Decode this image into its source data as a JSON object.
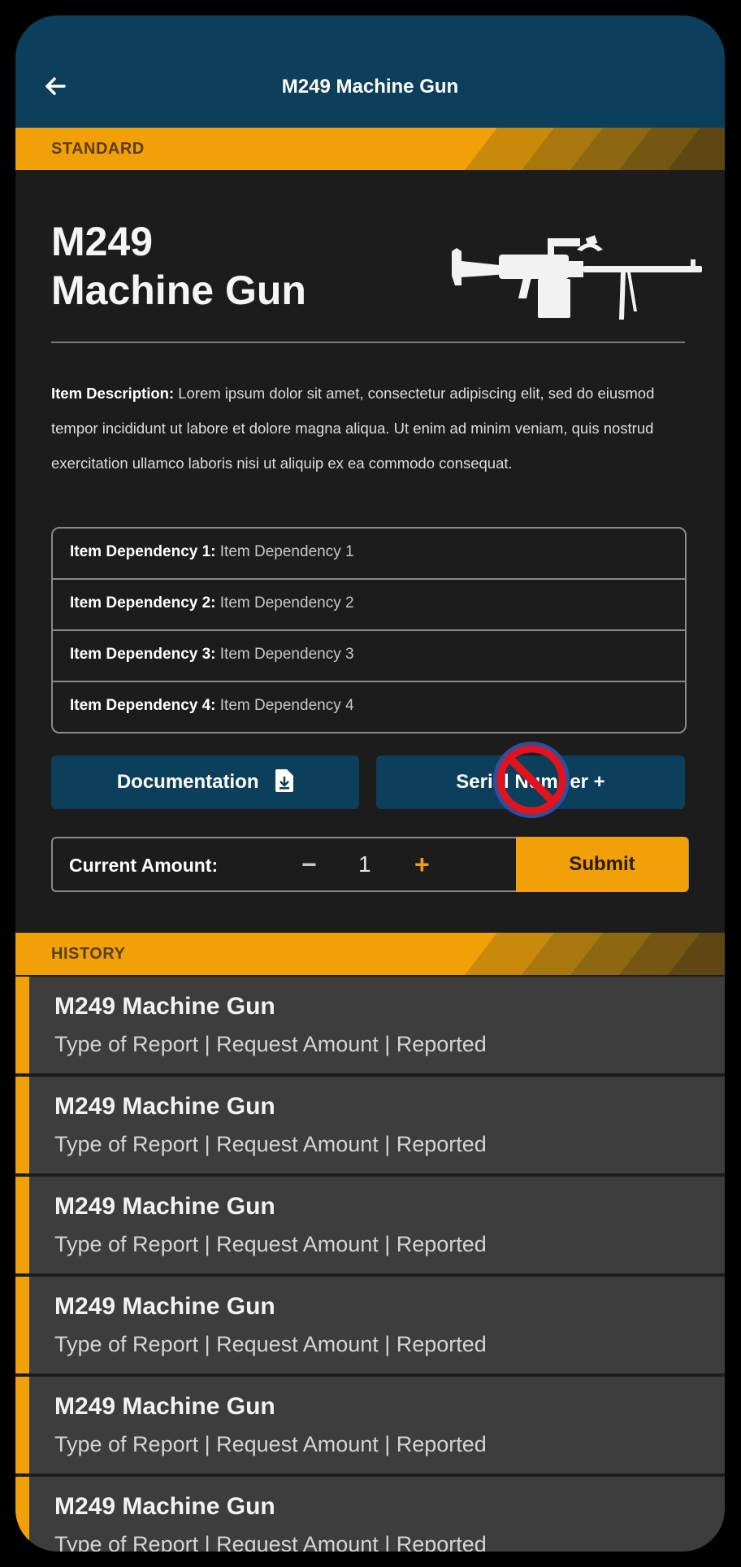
{
  "header": {
    "title": "M249 Machine Gun"
  },
  "item": {
    "category": "STANDARD",
    "name": "M249\nMachine Gun",
    "description_label": "Item Description:",
    "description": " Lorem ipsum dolor sit amet, consectetur adipiscing elit, sed do eiusmod tempor incididunt ut labore et dolore magna aliqua. Ut enim ad minim veniam, quis nostrud exercitation ullamco laboris nisi ut aliquip ex ea commodo consequat.",
    "dependencies": [
      {
        "label": "Item Dependency 1:",
        "value": " Item Dependency 1"
      },
      {
        "label": "Item Dependency 2:",
        "value": " Item Dependency 2"
      },
      {
        "label": "Item Dependency 3:",
        "value": " Item Dependency 3"
      },
      {
        "label": "Item Dependency 4:",
        "value": " Item Dependency 4"
      }
    ]
  },
  "actions": {
    "documentation_label": "Documentation",
    "serial_label": "Serial Number +"
  },
  "amount": {
    "label": "Current Amount:",
    "minus": "−",
    "value": "1",
    "plus": "+",
    "submit_label": "Submit"
  },
  "history": {
    "label": "HISTORY",
    "items": [
      {
        "title": "M249 Machine Gun",
        "subtitle": "Type of Report | Request Amount | Reported"
      },
      {
        "title": "M249 Machine Gun",
        "subtitle": "Type of Report | Request Amount | Reported"
      },
      {
        "title": "M249 Machine Gun",
        "subtitle": "Type of Report | Request Amount | Reported"
      },
      {
        "title": "M249 Machine Gun",
        "subtitle": "Type of Report | Request Amount | Reported"
      },
      {
        "title": "M249 Machine Gun",
        "subtitle": "Type of Report | Request Amount | Reported"
      },
      {
        "title": "M249 Machine Gun",
        "subtitle": "Type of Report | Request Amount | Reported"
      }
    ]
  },
  "colors": {
    "header": "#0b3f5b",
    "accent": "#f2a007",
    "background": "#1c1c1c",
    "card": "#3d3d3d"
  },
  "icons": [
    "arrow-left-icon",
    "machine-gun-icon",
    "document-download-icon",
    "no-entry-icon"
  ]
}
